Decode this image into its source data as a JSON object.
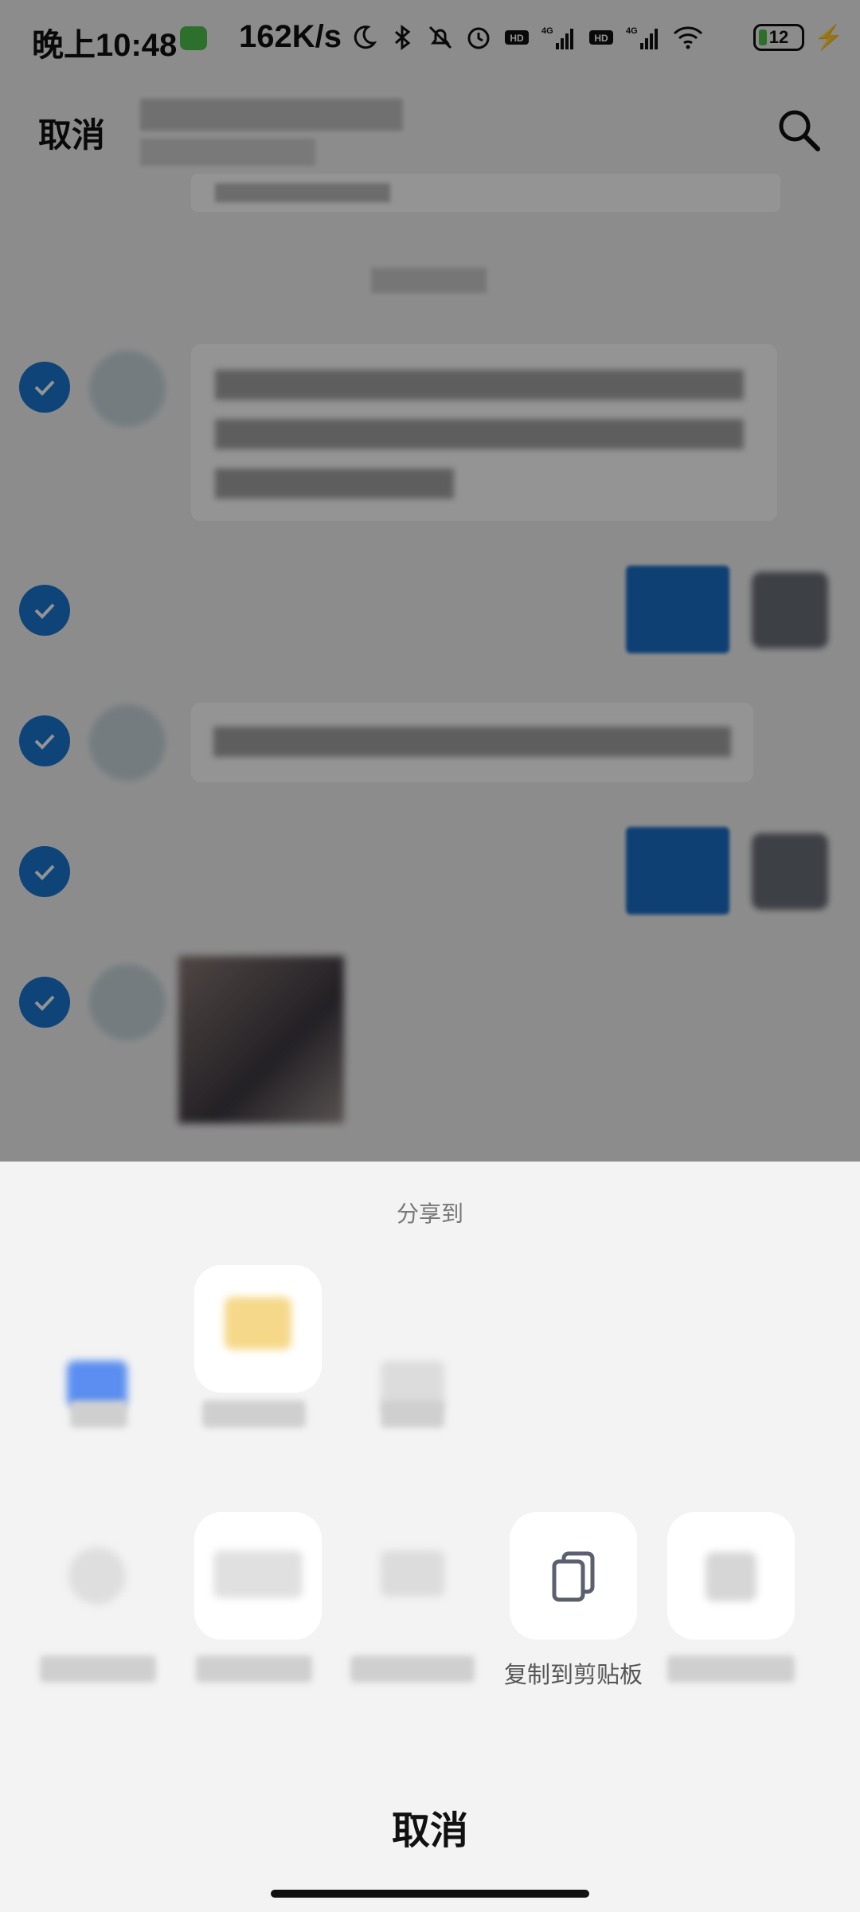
{
  "status_bar": {
    "time": "晚上10:48",
    "network_speed": "162K/s",
    "battery_level": "12",
    "icons": [
      "moon-icon",
      "bluetooth-icon",
      "mute-icon",
      "alarm-icon",
      "hd-icon",
      "signal-4g-icon",
      "hd-icon",
      "signal-4g-icon",
      "wifi-icon",
      "battery-icon",
      "charging-icon"
    ]
  },
  "header": {
    "cancel_label": "取消",
    "search_icon": "search-icon"
  },
  "messages": [
    {
      "side": "left",
      "selected": true
    },
    {
      "side": "right",
      "selected": true
    },
    {
      "side": "left",
      "selected": true
    },
    {
      "side": "right",
      "selected": true
    },
    {
      "side": "left",
      "selected": true
    }
  ],
  "share_sheet": {
    "title": "分享到",
    "copy_label": "复制到剪贴板",
    "copy_icon": "copy-icon",
    "cancel_label": "取消"
  },
  "colors": {
    "check_blue": "#1a76d0",
    "sheet_bg": "#f3f3f3",
    "tile_bg": "#ffffff"
  }
}
